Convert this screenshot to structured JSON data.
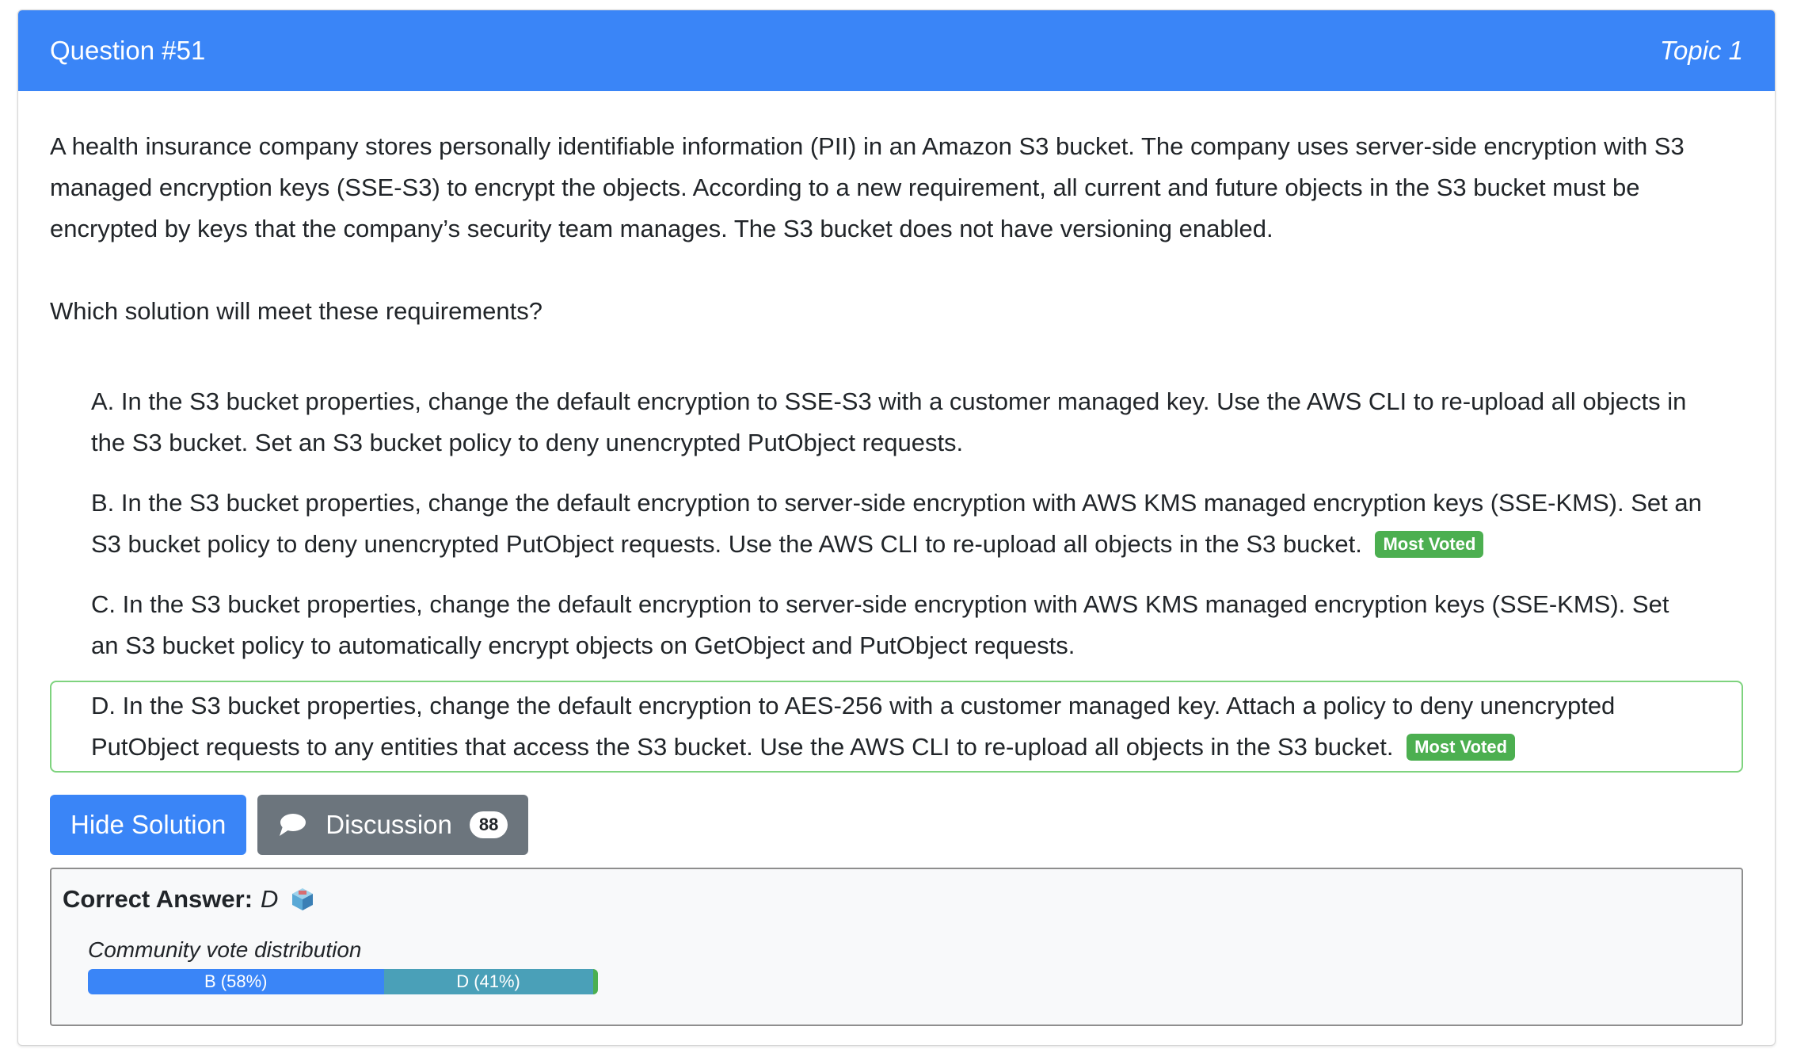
{
  "header": {
    "question_label": "Question #51",
    "topic_label": "Topic 1"
  },
  "question": {
    "text": "A health insurance company stores personally identifiable information (PII) in an Amazon S3 bucket. The company uses server-side encryption with S3 managed encryption keys (SSE-S3) to encrypt the objects. According to a new requirement, all current and future objects in the S3 bucket must be encrypted by keys that the company’s security team manages. The S3 bucket does not have versioning enabled.",
    "prompt": "Which solution will meet these requirements?"
  },
  "choices": [
    {
      "text": "A. In the S3 bucket properties, change the default encryption to SSE-S3 with a customer managed key. Use the AWS CLI to re-upload all objects in the S3 bucket. Set an S3 bucket policy to deny unencrypted PutObject requests.",
      "badge": ""
    },
    {
      "text": "B. In the S3 bucket properties, change the default encryption to server-side encryption with AWS KMS managed encryption keys (SSE-KMS). Set an S3 bucket policy to deny unencrypted PutObject requests. Use the AWS CLI to re-upload all objects in the S3 bucket.",
      "badge": "Most Voted"
    },
    {
      "text": "C. In the S3 bucket properties, change the default encryption to server-side encryption with AWS KMS managed encryption keys (SSE-KMS). Set an S3 bucket policy to automatically encrypt objects on GetObject and PutObject requests.",
      "badge": ""
    },
    {
      "text": "D. In the S3 bucket properties, change the default encryption to AES-256 with a customer managed key. Attach a policy to deny unencrypted PutObject requests to any entities that access the S3 bucket. Use the AWS CLI to re-upload all objects in the S3 bucket.",
      "badge": "Most Voted"
    }
  ],
  "actions": {
    "hide_solution_label": "Hide Solution",
    "discussion_label": "Discussion",
    "discussion_count": "88"
  },
  "answer": {
    "label": "Correct Answer:",
    "value": "D",
    "vote_title": "Community vote distribution",
    "votes": [
      {
        "label": "B (58%)",
        "percent": 58
      },
      {
        "label": "D (41%)",
        "percent": 41
      }
    ],
    "vote_remainder_percent": 1
  },
  "colors": {
    "primary": "#3a85f7",
    "success": "#4caf50",
    "secondary": "#6c757d",
    "vote_d": "#4aa0b8"
  },
  "icons": {
    "discussion": "chat-bubble-icon",
    "answer": "cube-icon"
  }
}
